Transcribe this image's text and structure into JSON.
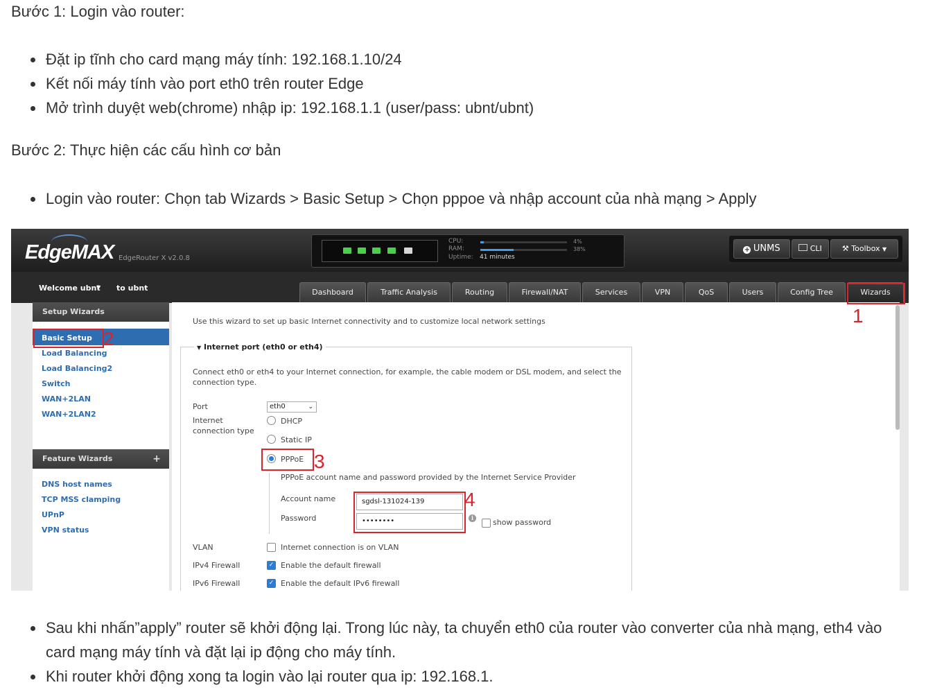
{
  "doc": {
    "step1_title": "Bước 1: Login vào router:",
    "step1_items": [
      "Đặt ip tĩnh cho card mạng máy tính: 192.168.1.10/24",
      "Kết nối máy tính vào port eth0 trên router Edge",
      "Mở trình duyệt web(chrome) nhập ip: 192.168.1.1 (user/pass: ubnt/ubnt)"
    ],
    "step2_title": "Bước 2: Thực hiện các cấu hình cơ bản",
    "step2_items": [
      "Login vào router: Chọn tab Wizards > Basic Setup > Chọn pppoe và nhập account của nhà mạng > Apply"
    ],
    "after_items": [
      "Sau khi nhấn”apply” router sẽ khởi động lại. Trong lúc này, ta chuyển eth0 của router vào converter của nhà mạng, eth4 vào card mạng máy tính và đặt lại ip động cho máy tính.",
      "Khi router khởi động xong ta login vào lại router qua ip: 192.168.1."
    ]
  },
  "router": {
    "brand": "EdgeMAX",
    "version": "EdgeRouter X v2.0.8",
    "cpu_label": "CPU:",
    "cpu_pct": "4%",
    "cpu_value": 0.04,
    "ram_label": "RAM:",
    "ram_pct": "38%",
    "ram_value": 0.38,
    "uptime_label": "Uptime:",
    "uptime_value": "41 minutes",
    "unms_label": "UNMS",
    "cli_label": "CLI",
    "toolbox_label": "Toolbox",
    "welcome": "Welcome ubnt",
    "to_ubnt": "to ubnt",
    "tabs": [
      "Dashboard",
      "Traffic Analysis",
      "Routing",
      "Firewall/NAT",
      "Services",
      "VPN",
      "QoS",
      "Users",
      "Config Tree",
      "Wizards"
    ],
    "sidebar": {
      "setup_title": "Setup Wizards",
      "setup_items": [
        "Basic Setup",
        "Load Balancing",
        "Load Balancing2",
        "Switch",
        "WAN+2LAN",
        "WAN+2LAN2"
      ],
      "feature_title": "Feature Wizards",
      "feature_plus": "+",
      "feature_items": [
        "DNS host names",
        "TCP MSS clamping",
        "UPnP",
        "VPN status"
      ]
    },
    "wizard": {
      "intro": "Use this wizard to set up basic Internet connectivity and to customize local network settings",
      "section_title": "Internet port (eth0 or eth4)",
      "connect_text_1": "Connect eth0 or eth4 to your Internet connection, for example, the cable modem or DSL modem, and select the",
      "connect_text_2": "connection type.",
      "port_label": "Port",
      "port_value": "eth0",
      "conn_type_label_1": "Internet",
      "conn_type_label_2": "connection type",
      "opt_dhcp": "DHCP",
      "opt_static": "Static IP",
      "opt_pppoe": "PPPoE",
      "pppoe_note": "PPPoE account name and password provided by the Internet Service Provider",
      "account_label": "Account name",
      "account_value": "sgdsl-131024-139",
      "password_label": "Password",
      "password_value": "••••••••",
      "show_password": "show password",
      "vlan_label": "VLAN",
      "vlan_text": "Internet connection is on VLAN",
      "ipv4_label": "IPv4 Firewall",
      "ipv4_text": "Enable the default firewall",
      "ipv6_label": "IPv6 Firewall",
      "ipv6_text": "Enable the default IPv6 firewall"
    },
    "annotations": [
      "1",
      "2",
      "3",
      "4"
    ],
    "annotation_color": "#d9232d"
  }
}
